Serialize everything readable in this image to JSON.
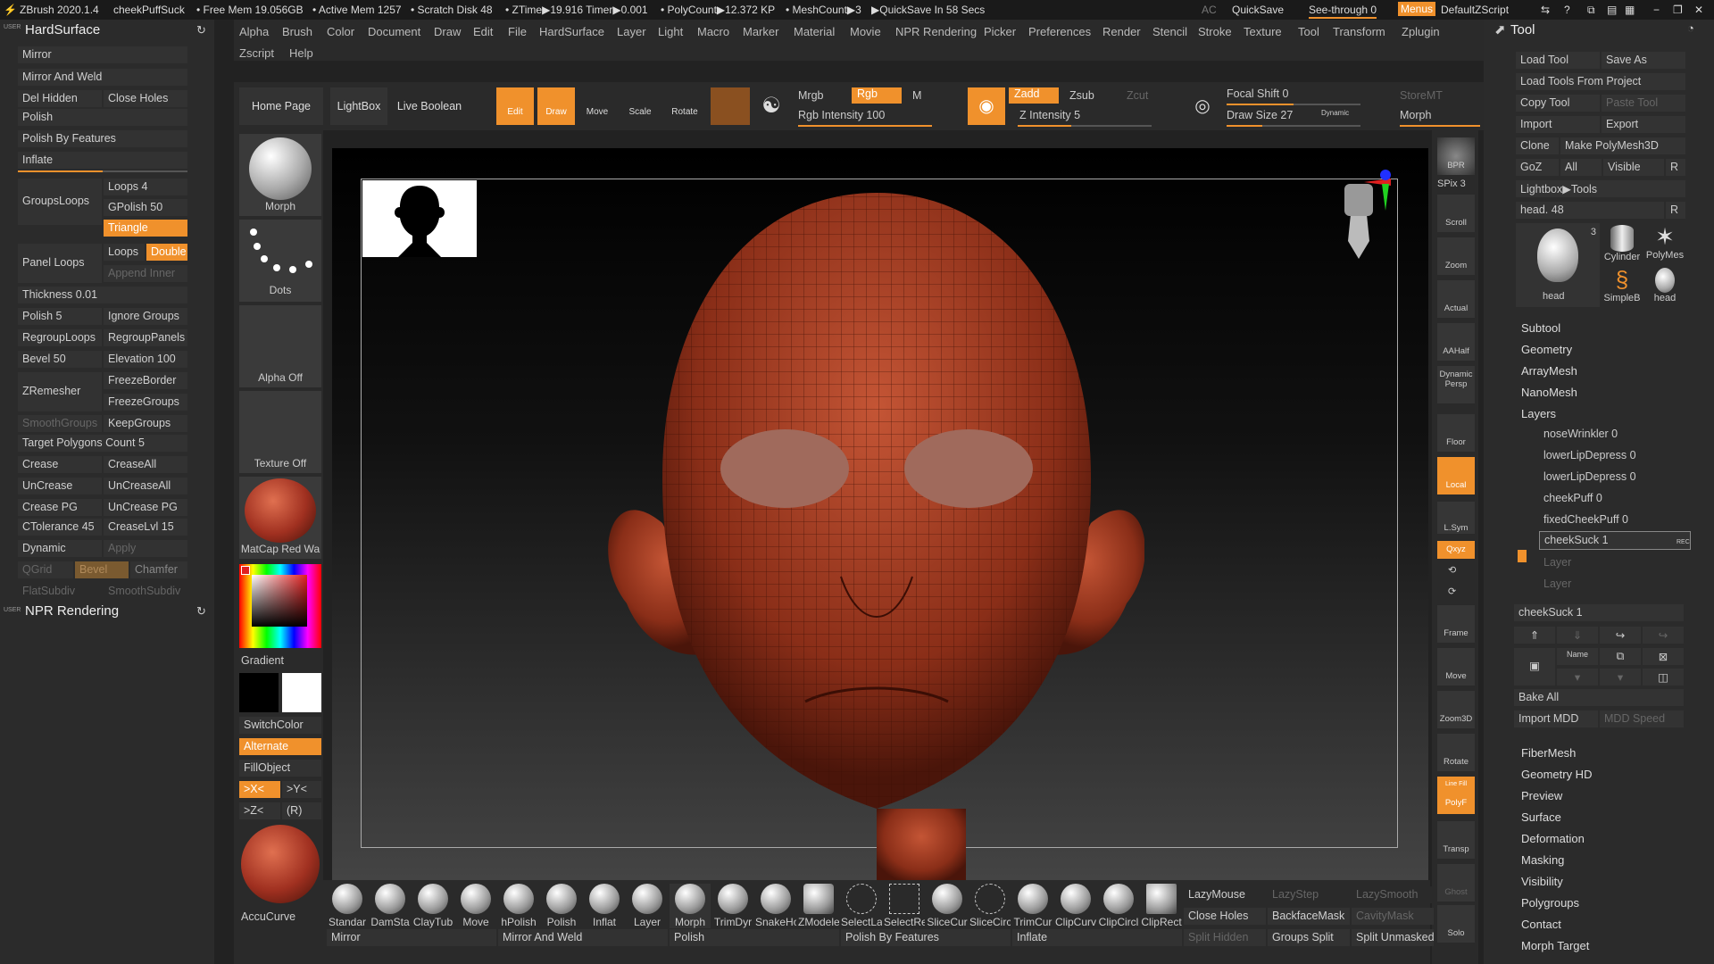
{
  "titlebar": {
    "app": "ZBrush 2020.1.4",
    "doc": "cheekPuffSuck",
    "free_mem": "• Free Mem 19.056GB",
    "active_mem": "• Active Mem 1257",
    "scratch": "• Scratch Disk 48",
    "ztime": "• ZTime▶19.916 Timer▶0.001",
    "polycount": "• PolyCount▶12.372 KP",
    "meshcount": "• MeshCount▶3",
    "quicksave_in": "▶QuickSave In 58 Secs",
    "ac": "AC",
    "quicksave": "QuickSave",
    "see_through": "See-through 0",
    "menus": "Menus",
    "script": "DefaultZScript"
  },
  "menubar": {
    "items": [
      "Alpha",
      "Brush",
      "Color",
      "Document",
      "Draw",
      "Edit",
      "File",
      "HardSurface",
      "Layer",
      "Light",
      "Macro",
      "Marker",
      "Material",
      "Movie",
      "NPR Rendering",
      "Picker",
      "Preferences",
      "Render",
      "Stencil",
      "Stroke",
      "Texture",
      "Tool",
      "Transform",
      "Zplugin"
    ],
    "row2": [
      "Zscript",
      "Help"
    ]
  },
  "left": {
    "title": "HardSurface",
    "title2": "NPR Rendering",
    "user1": "USER",
    "user2": "USER",
    "mirror": "Mirror",
    "mirror_weld": "Mirror And Weld",
    "del_hidden": "Del Hidden",
    "close_holes": "Close Holes",
    "polish": "Polish",
    "polish_features": "Polish By Features",
    "inflate": "Inflate",
    "groupsloops": "GroupsLoops",
    "loops": "Loops 4",
    "gpolish": "GPolish 50",
    "triangle": "Triangle",
    "panel_loops": "Panel Loops",
    "loops2": "Loops",
    "double": "Double",
    "append_inner": "Append Inner",
    "thickness": "Thickness 0.01",
    "polish5": "Polish 5",
    "ignore_groups": "Ignore Groups",
    "regroup_loops": "RegroupLoops",
    "regroup_panels": "RegroupPanels",
    "bevel": "Bevel 50",
    "elevation": "Elevation 100",
    "zremesher": "ZRemesher",
    "freeze_border": "FreezeBorder",
    "freeze_groups": "FreezeGroups",
    "smooth_groups": "SmoothGroups",
    "keep_groups": "KeepGroups",
    "target_poly": "Target Polygons Count 5",
    "crease": "Crease",
    "crease_all": "CreaseAll",
    "uncrease": "UnCrease",
    "uncrease_all": "UnCreaseAll",
    "crease_pg": "Crease PG",
    "uncrease_pg": "UnCrease PG",
    "ctolerance": "CTolerance 45",
    "crease_lvl": "CreaseLvl 15",
    "dynamic": "Dynamic",
    "apply": "Apply",
    "qgrid": "QGrid",
    "bevel2": "Bevel",
    "chamfer": "Chamfer",
    "flat_subdiv": "FlatSubdiv",
    "smooth_subdiv": "SmoothSubdiv"
  },
  "toolbar": {
    "home": "Home Page",
    "lightbox": "LightBox",
    "live_boolean": "Live Boolean",
    "edit": "Edit",
    "draw": "Draw",
    "move": "Move",
    "scale": "Scale",
    "rotate": "Rotate",
    "mrgb": "Mrgb",
    "rgb": "Rgb",
    "m": "M",
    "rgb_intensity": "Rgb Intensity 100",
    "zadd": "Zadd",
    "zsub": "Zsub",
    "zcut": "Zcut",
    "z_intensity": "Z Intensity 5",
    "focal_shift": "Focal Shift 0",
    "draw_size": "Draw Size 27",
    "dynamic": "Dynamic",
    "storemt": "StoreMT",
    "morph": "Morph"
  },
  "shelf": {
    "morph": "Morph",
    "dots": "Dots",
    "alpha_off": "Alpha Off",
    "texture_off": "Texture Off",
    "matcap": "MatCap Red Wa",
    "gradient": "Gradient",
    "switch_color": "SwitchColor",
    "alternate": "Alternate",
    "fill_object": "FillObject",
    "xm": ">X<",
    "ym": ">Y<",
    "zm": ">Z<",
    "r": "(R)",
    "accucurve": "AccuCurve"
  },
  "rightshelf": {
    "bpr": "BPR",
    "spix": "SPix 3",
    "scroll": "Scroll",
    "zoom": "Zoom",
    "actual": "Actual",
    "aahalf": "AAHalf",
    "persp": "Persp",
    "dynamic": "Dynamic",
    "floor": "Floor",
    "local": "Local",
    "lsym": "L.Sym",
    "xyz": "Qxyz",
    "frame": "Frame",
    "move": "Move",
    "zoom3d": "Zoom3D",
    "rotate": "Rotate",
    "polyf": "PolyF",
    "linefill": "Line Fill",
    "transp": "Transp",
    "ghost": "Ghost",
    "solo": "Solo"
  },
  "brushes": [
    "Standar",
    "DamSta",
    "ClayTub",
    "Move",
    "hPolish",
    "Polish",
    "Inflat",
    "Layer",
    "Morph",
    "TrimDyr",
    "SnakeHo",
    "ZModele",
    "SelectLa",
    "SelectRe",
    "SliceCur",
    "SliceCirc",
    "TrimCur",
    "ClipCurv",
    "ClipCircl",
    "ClipRect"
  ],
  "bottom": {
    "lazymouse": "LazyMouse",
    "lazystep": "LazyStep",
    "lazysmooth": "LazySmooth",
    "close_holes": "Close Holes",
    "backface": "BackfaceMask",
    "cavity": "CavityMask",
    "split_hidden": "Split Hidden",
    "groups_split": "Groups Split",
    "split_unmasked": "Split Unmasked",
    "mirror": "Mirror",
    "mirror_weld": "Mirror And Weld",
    "polish": "Polish",
    "polish_features": "Polish By Features",
    "inflate": "Inflate"
  },
  "tool": {
    "title": "Tool",
    "load_tool": "Load Tool",
    "save_as": "Save As",
    "load_from_project": "Load Tools From Project",
    "copy_tool": "Copy Tool",
    "paste_tool": "Paste Tool",
    "import": "Import",
    "export": "Export",
    "clone": "Clone",
    "make_polymesh": "Make PolyMesh3D",
    "goz": "GoZ",
    "all": "All",
    "visible": "Visible",
    "r": "R",
    "lightbox_tools": "Lightbox▶Tools",
    "head48": "head. 48",
    "thumbs": [
      "head",
      "Cylinder",
      "PolyMes",
      "SimpleB",
      "head"
    ],
    "count3": "3",
    "sections": [
      "Subtool",
      "Geometry",
      "ArrayMesh",
      "NanoMesh"
    ],
    "layers": "Layers",
    "layer_items": [
      "noseWrinkler 0",
      "lowerLipDepress 0",
      "lowerLipDepress 0",
      "cheekPuff 0",
      "fixedCheekPuff 0",
      "cheekSuck 1",
      "Layer",
      "Layer"
    ],
    "rec": "REC",
    "cheeksuck_slider": "cheekSuck 1",
    "name": "Name",
    "bake_all": "Bake All",
    "import_mdd": "Import MDD",
    "mdd_speed": "MDD Speed",
    "sections2": [
      "FiberMesh",
      "Geometry HD",
      "Preview",
      "Surface",
      "Deformation",
      "Masking",
      "Visibility",
      "Polygroups",
      "Contact",
      "Morph Target"
    ]
  }
}
